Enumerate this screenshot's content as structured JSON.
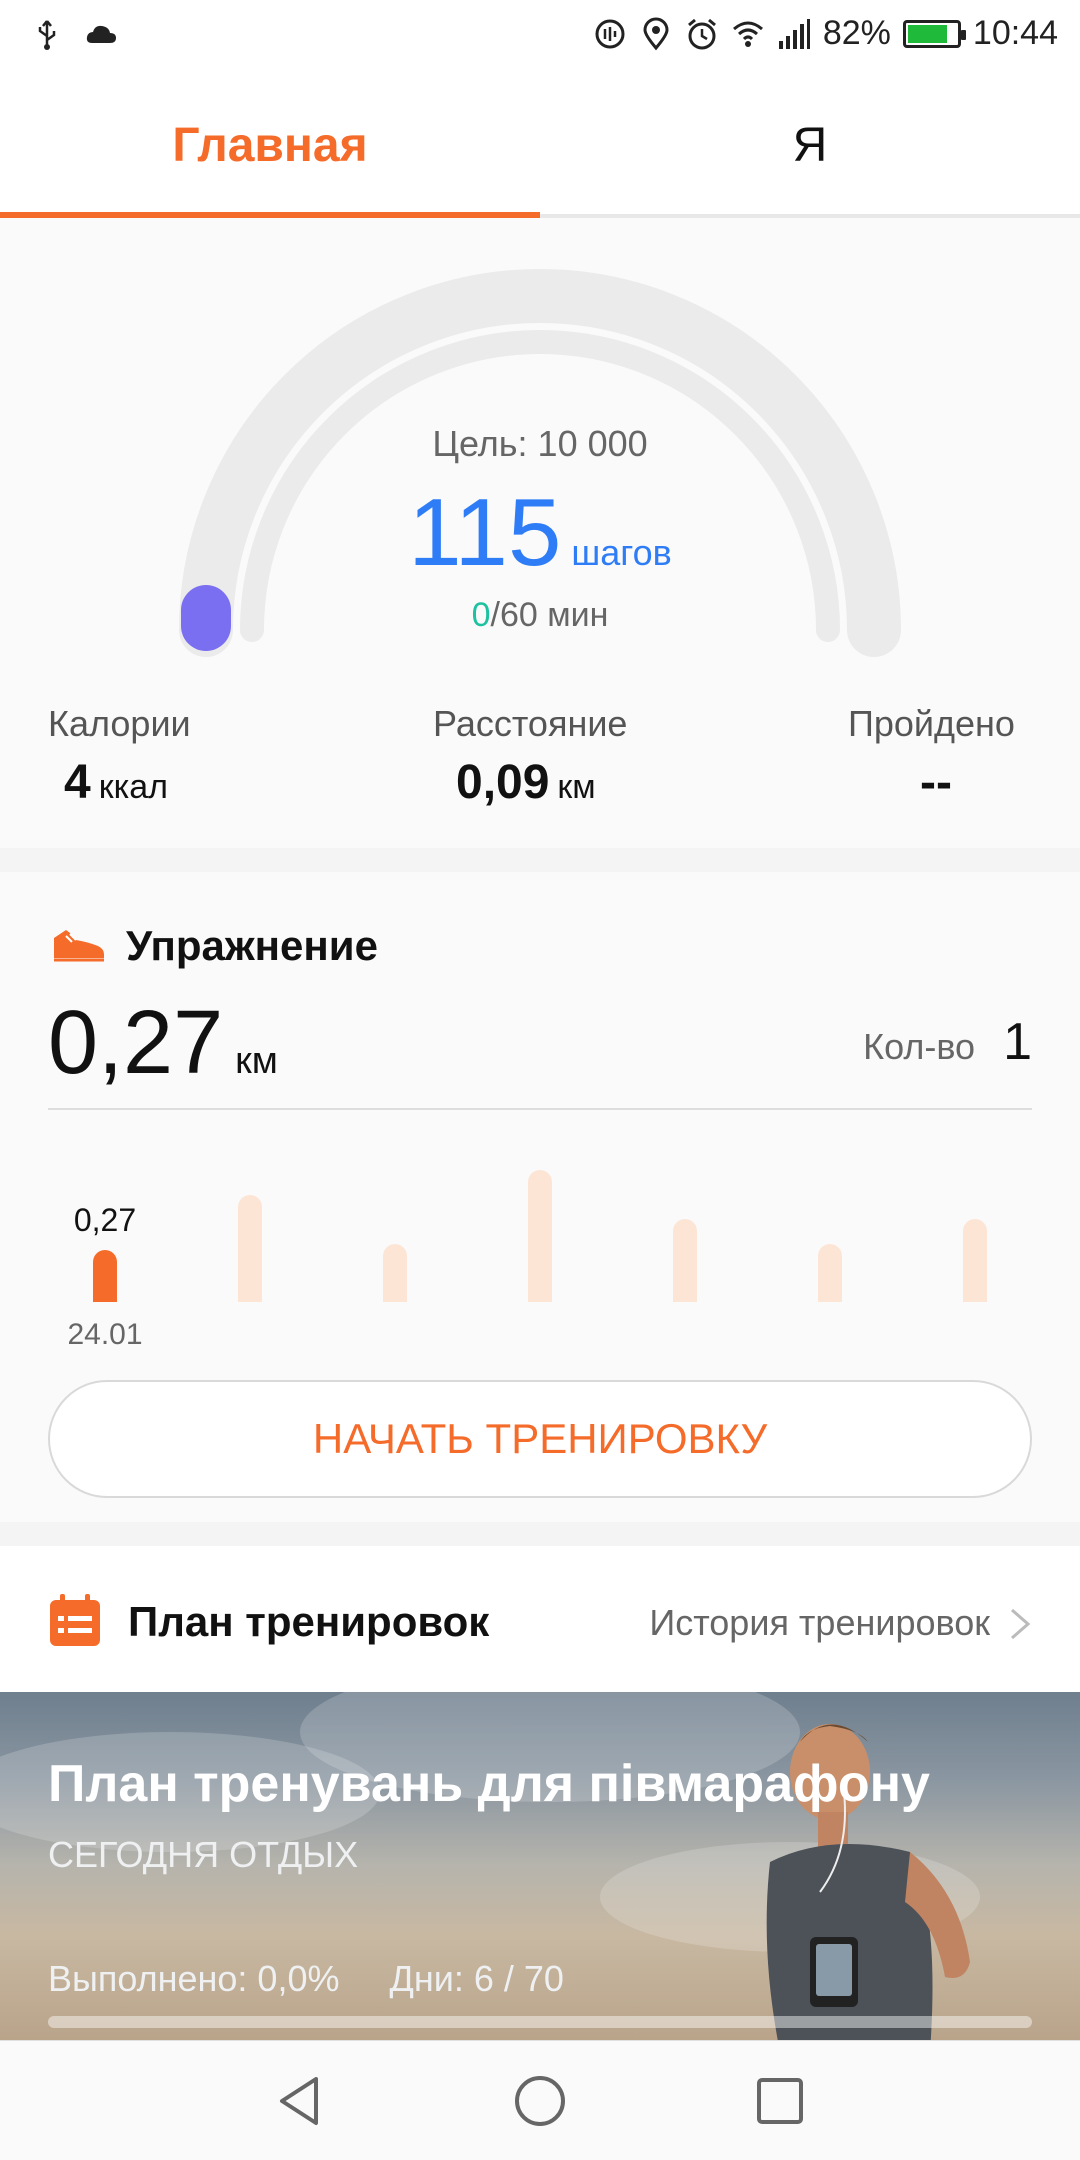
{
  "status_bar": {
    "battery_percent": "82%",
    "time": "10:44",
    "icons_left": [
      "usb-icon",
      "cloud-icon"
    ],
    "icons_right": [
      "data-saver-icon",
      "location-icon",
      "alarm-icon",
      "wifi-icon",
      "signal-icon",
      "battery-icon"
    ]
  },
  "tabs": {
    "home": "Главная",
    "me": "Я"
  },
  "steps": {
    "goal": "Цель: 10 000",
    "count": "115",
    "unit": "шагов",
    "minutes_done": "0",
    "minutes_goal": "/60 мин",
    "progress_fraction": 0.0115
  },
  "stats": {
    "calories_label": "Калории",
    "calories_value": "4",
    "calories_unit": "ккал",
    "distance_label": "Расстояние",
    "distance_value": "0,09",
    "distance_unit": "км",
    "passed_label": "Пройдено",
    "passed_value": "--"
  },
  "exercise": {
    "title": "Упражнение",
    "distance": "0,27",
    "unit": "км",
    "count_label": "Кол-во",
    "count_value": "1",
    "start_button": "НАЧАТЬ ТРЕНИРОВКУ",
    "chart": {
      "today_value_label": "0,27",
      "today_date_label": "24.01"
    }
  },
  "chart_data": {
    "type": "bar",
    "categories": [
      "24.01",
      "",
      "",
      "",
      "",
      "",
      ""
    ],
    "values": [
      0.27,
      0.55,
      0.3,
      0.68,
      0.43,
      0.3,
      0.43
    ],
    "highlight_index": 0,
    "title": "",
    "xlabel": "",
    "ylabel": ""
  },
  "plan": {
    "title": "План тренировок",
    "history_link": "История тренировок",
    "banner_title": "План тренувань для півмарафону",
    "banner_subtitle": "СЕГОДНЯ ОТДЫХ",
    "completed": "Выполнено: 0,0%",
    "days": "Дни: 6 / 70",
    "progress_fraction": 0.0
  },
  "colors": {
    "accent": "#f56b2a",
    "steps_blue": "#2f7df6",
    "gauge_knob": "#7a6ff0",
    "minutes_green": "#1ec2a0"
  }
}
